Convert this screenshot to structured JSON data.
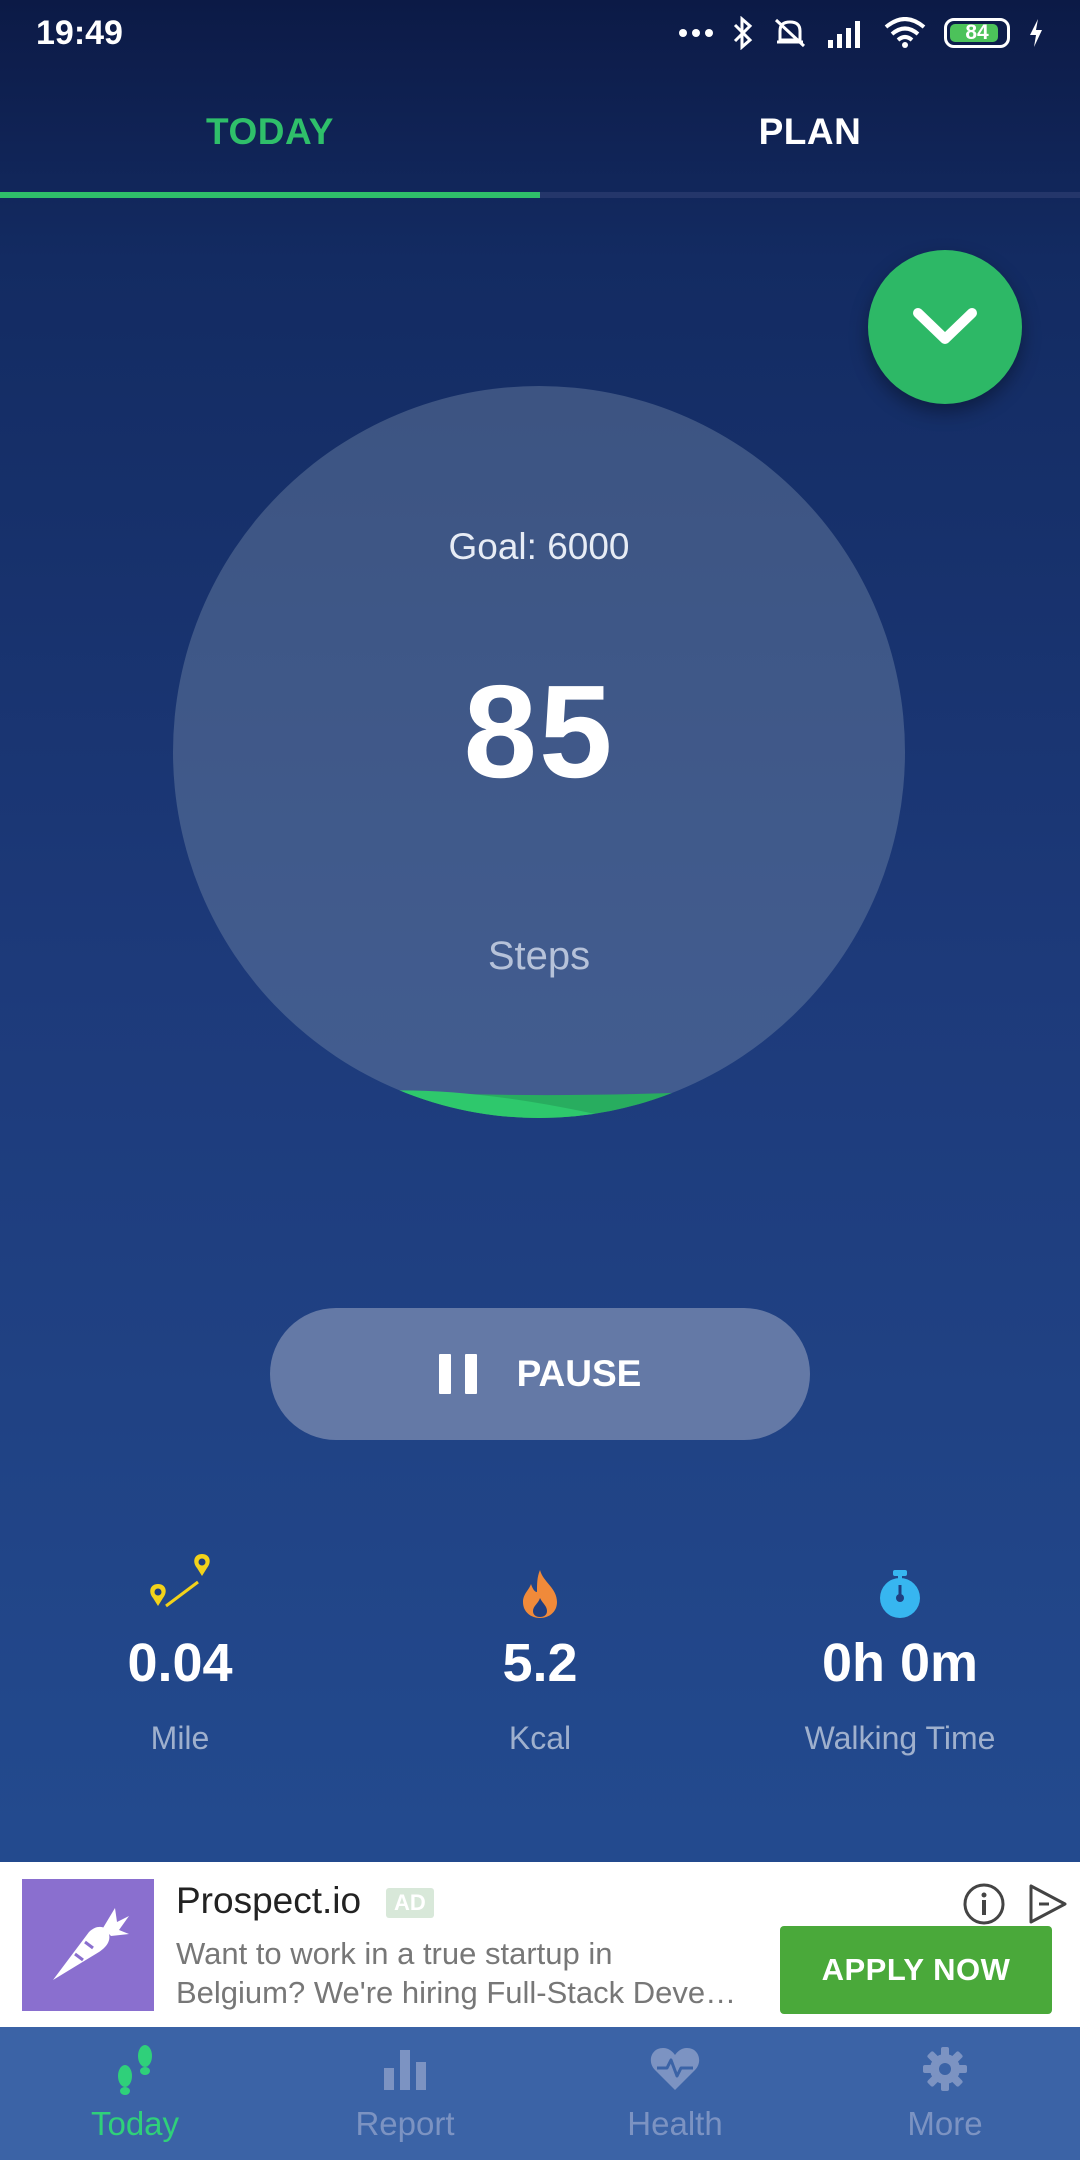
{
  "status_bar": {
    "time": "19:49",
    "battery": "84",
    "icons": [
      "more-dots-icon",
      "bluetooth-icon",
      "mute-icon",
      "signal-icon",
      "wifi-icon",
      "battery-icon",
      "charging-icon"
    ]
  },
  "tabs": [
    {
      "label": "TODAY",
      "active": true
    },
    {
      "label": "PLAN",
      "active": false
    }
  ],
  "tracker": {
    "goal_text": "Goal: 6000",
    "steps_value": "85",
    "steps_label": "Steps",
    "progress_fraction": 0.014
  },
  "pause_button": {
    "label": "PAUSE"
  },
  "stats": [
    {
      "icon": "distance-pins-icon",
      "value": "0.04",
      "label": "Mile"
    },
    {
      "icon": "flame-icon",
      "value": "5.2",
      "label": "Kcal"
    },
    {
      "icon": "stopwatch-icon",
      "value": "0h 0m",
      "label": "Walking Time"
    }
  ],
  "ad": {
    "title": "Prospect.io",
    "badge": "AD",
    "body_line1": "Want to work in a true startup in",
    "body_line2": "Belgium? We're hiring Full-Stack Deve…",
    "cta": "APPLY NOW"
  },
  "bottom_nav": [
    {
      "icon": "footsteps-icon",
      "label": "Today",
      "active": true
    },
    {
      "icon": "bar-chart-icon",
      "label": "Report",
      "active": false
    },
    {
      "icon": "heart-pulse-icon",
      "label": "Health",
      "active": false
    },
    {
      "icon": "gear-icon",
      "label": "More",
      "active": false
    }
  ],
  "colors": {
    "accent": "#2fbf6a",
    "pause_button": "#6479a6",
    "ad_cta": "#4aa93a",
    "nav_background": "#3b63a6"
  }
}
